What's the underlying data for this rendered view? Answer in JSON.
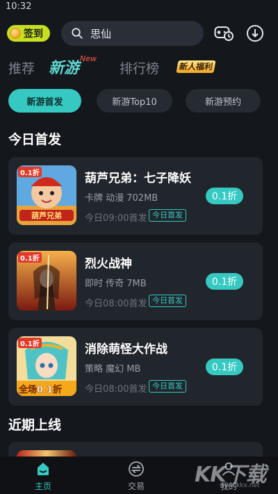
{
  "status_bar": {
    "time": "10:32"
  },
  "header": {
    "sign_in_label": "签到",
    "search_value": "思仙"
  },
  "tabs": [
    {
      "label": "推荐"
    },
    {
      "label": "新游",
      "superscript": "New",
      "active": true
    },
    {
      "label": "排行榜"
    },
    {
      "label": "新人福利"
    }
  ],
  "chips": [
    {
      "label": "新游首发",
      "active": true
    },
    {
      "label": "新游Top10"
    },
    {
      "label": "新游预约"
    }
  ],
  "sections": {
    "today": "今日首发",
    "upcoming": "近期上线"
  },
  "games": [
    {
      "name": "葫芦兄弟：七子降妖",
      "tags": "卡牌 动漫 702MB",
      "date": "今日09:00首发",
      "badge": "今日首发",
      "discount": "0.1折",
      "thumb_badge": "0.1折",
      "thumb_text": ""
    },
    {
      "name": "烈火战神",
      "tags": "即时 传奇 7MB",
      "date": "今日08:00首发",
      "badge": "今日首发",
      "discount": "0.1折",
      "thumb_badge": "0.1折",
      "thumb_text": ""
    },
    {
      "name": "消除萌怪大作战",
      "tags": "策略 魔幻 MB",
      "date": "今日08:00首发",
      "badge": "今日首发",
      "discount": "0.1折",
      "thumb_badge": "0.1折",
      "thumb_text": "全场0.1折"
    }
  ],
  "bottom_nav": [
    {
      "label": "主页",
      "active": true
    },
    {
      "label": "交易"
    },
    {
      "label": "我的"
    }
  ],
  "watermark": {
    "text": "KK下载",
    "sub": "www.kkx.net"
  },
  "colors": {
    "accent": "#35c9c2",
    "background": "#14171c",
    "card": "#21252c",
    "sign_in": "#c6e021"
  },
  "icons": [
    "coin-icon",
    "search-icon",
    "gamepad-clock-icon",
    "download-icon",
    "home-icon",
    "trade-icon",
    "profile-icon"
  ]
}
